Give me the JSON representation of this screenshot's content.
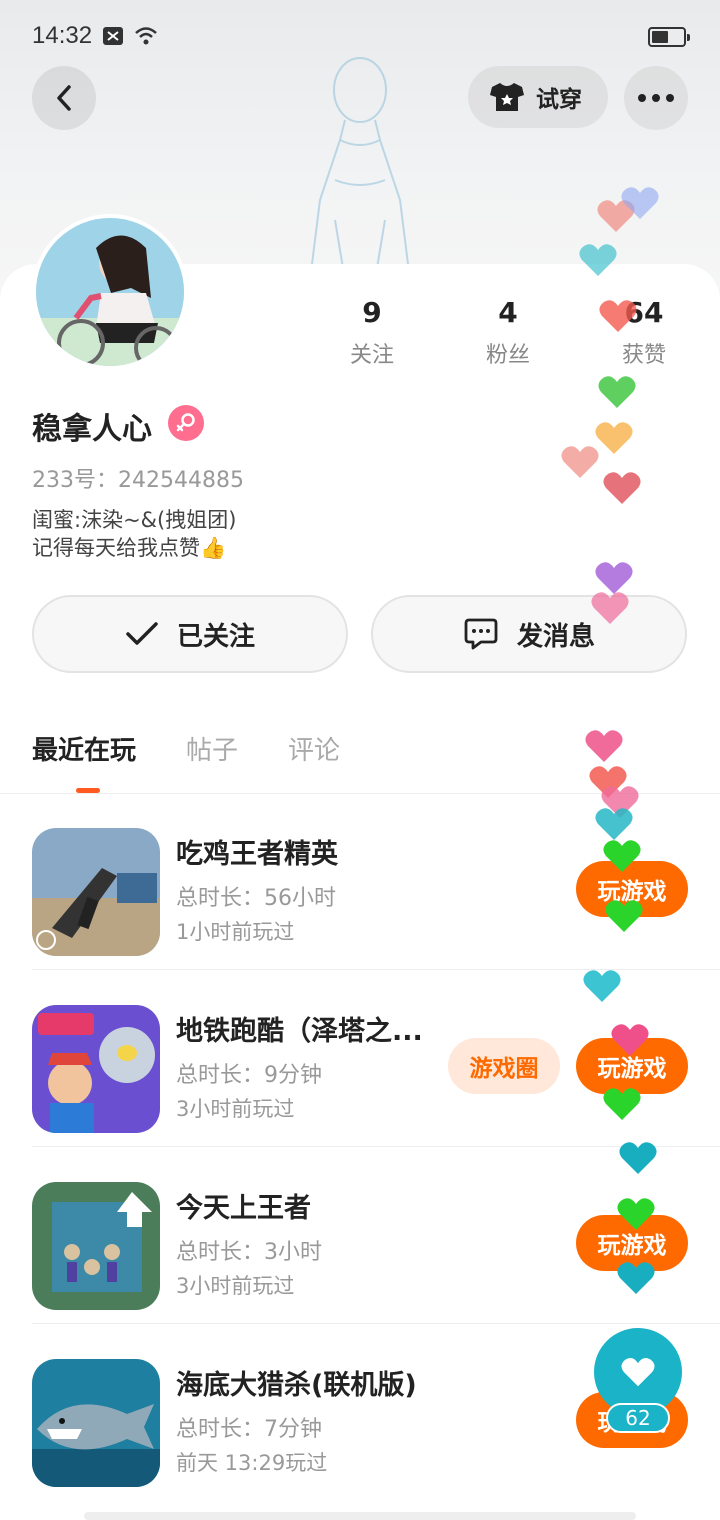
{
  "status_bar": {
    "time": "14:32"
  },
  "header": {
    "tryon_label": "试穿"
  },
  "profile": {
    "name": "稳拿人心",
    "uid": "233号：242544885",
    "bio_line1": "闺蜜:沫染~&(拽姐团)",
    "bio_line2": "记得每天给我点赞👍",
    "stats": [
      {
        "value": "9",
        "label": "关注"
      },
      {
        "value": "4",
        "label": "粉丝"
      },
      {
        "value": "64",
        "label": "获赞"
      }
    ]
  },
  "actions": {
    "followed_label": "已关注",
    "message_label": "发消息"
  },
  "tabs": [
    {
      "label": "最近在玩",
      "active": true
    },
    {
      "label": "帖子",
      "active": false
    },
    {
      "label": "评论",
      "active": false
    }
  ],
  "games": [
    {
      "name": "吃鸡王者精英",
      "duration": "总时长：56小时",
      "last_played": "1小时前玩过",
      "play_label": "玩游戏",
      "circle_label": ""
    },
    {
      "name": "地铁跑酷（泽塔之...",
      "duration": "总时长：9分钟",
      "last_played": "3小时前玩过",
      "play_label": "玩游戏",
      "circle_label": "游戏圈"
    },
    {
      "name": "今天上王者",
      "duration": "总时长：3小时",
      "last_played": "3小时前玩过",
      "play_label": "玩游戏",
      "circle_label": ""
    },
    {
      "name": "海底大猎杀(联机版)",
      "duration": "总时长：7分钟",
      "last_played": "前天 13:29玩过",
      "play_label": "玩游戏",
      "circle_label": ""
    }
  ],
  "like_fab": {
    "count": "62"
  },
  "colors": {
    "accent": "#ff6a00",
    "like": "#1ab3c7",
    "gender": "#ff6d8f"
  }
}
